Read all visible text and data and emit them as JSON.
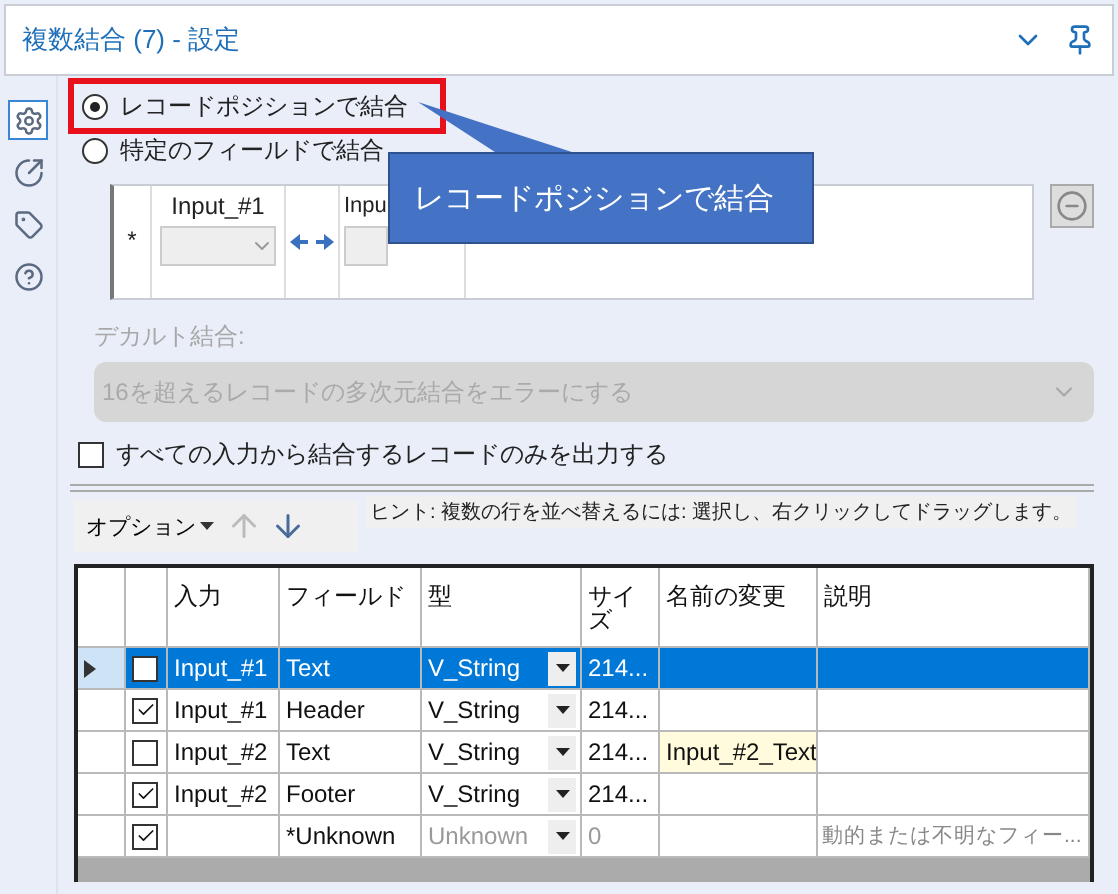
{
  "header": {
    "title": "複数結合 (7) - 設定"
  },
  "sidebar": {
    "items": [
      {
        "kind": "settings",
        "selected": true
      },
      {
        "kind": "output",
        "selected": false
      },
      {
        "kind": "tag",
        "selected": false
      },
      {
        "kind": "help",
        "selected": false
      }
    ]
  },
  "join_modes": [
    {
      "label": "レコードポジションで結合",
      "selected": true,
      "highlighted": true
    },
    {
      "label": "特定のフィールドで結合",
      "selected": false,
      "highlighted": false
    }
  ],
  "callout": {
    "text": "レコードポジションで結合"
  },
  "join_fields": {
    "marker": "*",
    "columns": [
      "Input_#1",
      "Inpu"
    ]
  },
  "cartesian": {
    "label": "デカルト結合:",
    "value": "16を超えるレコードの多次元結合をエラーにする",
    "disabled": true
  },
  "only_joined": {
    "label": "すべての入力から結合するレコードのみを出力する",
    "checked": false
  },
  "toolbar": {
    "options": "オプション",
    "hint": "ヒント: 複数の行を並べ替えるには: 選択し、右クリックしてドラッグします。"
  },
  "table": {
    "columns": [
      "入力",
      "フィールド",
      "型",
      "サイズ",
      "名前の変更",
      "説明"
    ],
    "rows": [
      {
        "kind": "field",
        "selected": true,
        "checked": false,
        "input": "Input_#1",
        "field": "Text",
        "type": "V_String",
        "size": "214...",
        "rename": "",
        "description": ""
      },
      {
        "kind": "field",
        "selected": false,
        "checked": true,
        "input": "Input_#1",
        "field": "Header",
        "type": "V_String",
        "size": "214...",
        "rename": "",
        "description": ""
      },
      {
        "kind": "field",
        "selected": false,
        "checked": false,
        "input": "Input_#2",
        "field": "Text",
        "type": "V_String",
        "size": "214...",
        "rename": "Input_#2_Text",
        "description": ""
      },
      {
        "kind": "field",
        "selected": false,
        "checked": true,
        "input": "Input_#2",
        "field": "Footer",
        "type": "V_String",
        "size": "214...",
        "rename": "",
        "description": ""
      },
      {
        "kind": "unknown",
        "selected": false,
        "checked": true,
        "input": "",
        "field": "*Unknown",
        "type": "Unknown",
        "size": "0",
        "rename": "",
        "description": "動的または不明なフィー..."
      }
    ]
  }
}
